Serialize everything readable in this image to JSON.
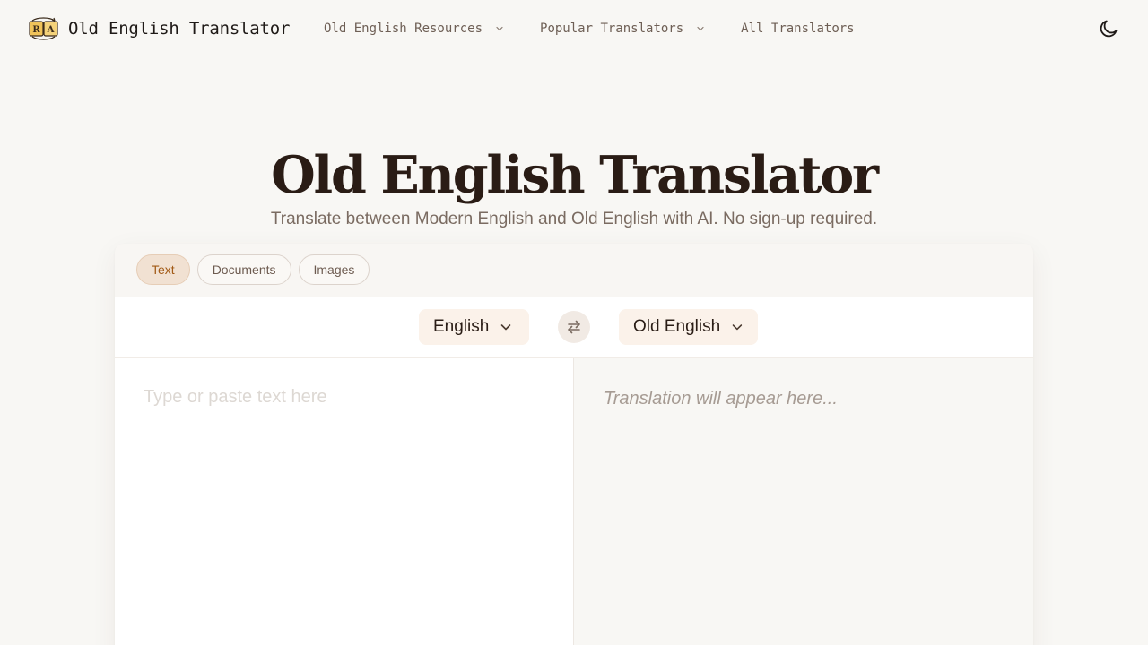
{
  "header": {
    "brand_name": "Old English Translator",
    "logo_icon": "book-translate-logo",
    "nav": [
      {
        "label": "Old English Resources",
        "has_dropdown": true
      },
      {
        "label": "Popular Translators",
        "has_dropdown": true
      },
      {
        "label": "All Translators",
        "has_dropdown": false
      }
    ],
    "theme_icon": "moon-icon"
  },
  "hero": {
    "title": "Old English Translator",
    "subtitle": "Translate between Modern English and Old English with AI. No sign-up required."
  },
  "translator": {
    "tabs": [
      {
        "label": "Text",
        "active": true
      },
      {
        "label": "Documents",
        "active": false
      },
      {
        "label": "Images",
        "active": false
      }
    ],
    "source_language": "English",
    "target_language": "Old English",
    "source_placeholder": "Type or paste text here",
    "source_value": "",
    "target_placeholder": "Translation will appear here..."
  },
  "colors": {
    "background": "#f8f7f4",
    "accent": "#a25a16",
    "active_tab_bg": "#f1e1d2",
    "title_text": "#2a1c15"
  }
}
